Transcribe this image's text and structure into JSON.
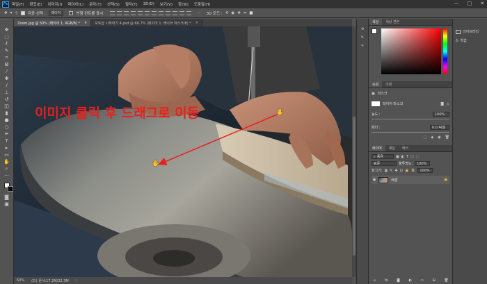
{
  "app": {
    "logo": "Ps"
  },
  "menu": [
    "파일(F)",
    "편집(E)",
    "이미지(I)",
    "레이어(L)",
    "문자(Y)",
    "선택(S)",
    "필터(T)",
    "3D(D)",
    "보기(V)",
    "창(W)",
    "도움말(H)"
  ],
  "window_controls": [
    "—",
    "□",
    "✕"
  ],
  "options": {
    "auto_select_label": "자동 선택 :",
    "auto_select_value": "레이어",
    "transform_label": "변형 컨트롤 표시",
    "mode_3d": "3D 모드 :"
  },
  "doc_tabs": [
    {
      "label": "Zoom.jpg @ 50% (레이어 1, RGB/8) *",
      "active": true
    },
    {
      "label": "포토샵 시작하기 4.psd @ 66.7% (레이어 1, 레이어 마스크/8) *",
      "active": false
    }
  ],
  "annotation": {
    "text": "이미지 클릭 후 드래그로 이동",
    "color": "#e8201c"
  },
  "status": {
    "zoom": "50%",
    "doc_size": "(드) 문서:17.2M/22.3M"
  },
  "color_panel": {
    "tabs": [
      "색상",
      "색상 견본"
    ]
  },
  "properties_panel": {
    "tabs": [
      "속성",
      "조정"
    ],
    "mask_header": "마스크",
    "layer_mask_label": "레이어 마스크",
    "density_label": "농도 :",
    "density_value": "100%",
    "feather_label": "페더 :",
    "feather_value": "0.0 픽셀"
  },
  "layers_panel": {
    "tabs": [
      "레이어",
      "채널",
      "패스"
    ],
    "filter_kind": "종류",
    "blend_mode": "표준",
    "opacity_label": "불투명도:",
    "opacity_value": "100%",
    "lock_label": "잠그기:",
    "fill_label": "칠:",
    "fill_value": "100%",
    "layers": [
      {
        "name": "배경",
        "locked": true
      }
    ]
  },
  "right_panel": {
    "items": [
      "라이브러리",
      "학습"
    ]
  }
}
